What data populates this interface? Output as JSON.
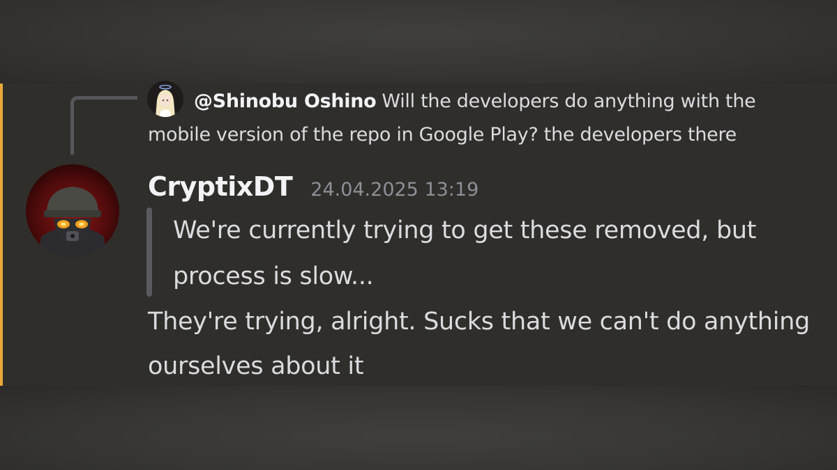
{
  "reply": {
    "author": "@Shinobu Oshino",
    "text": "Will the developers do anything with the mobile version of the repo in Google Play? the developers there"
  },
  "message": {
    "author": "CryptixDT",
    "timestamp": "24.04.2025 13:19",
    "quote": "We're currently trying to get these removed, but process is slow...",
    "content": "They're trying, alright. Sucks that we can't do anything ourselves about it"
  },
  "colors": {
    "highlight": "#e8a83a",
    "message_bg": "#302e2b",
    "text": "#dbdcdf",
    "author": "#f2f3f5",
    "timestamp": "#8e9097",
    "quote_bar": "#5a5b60"
  }
}
